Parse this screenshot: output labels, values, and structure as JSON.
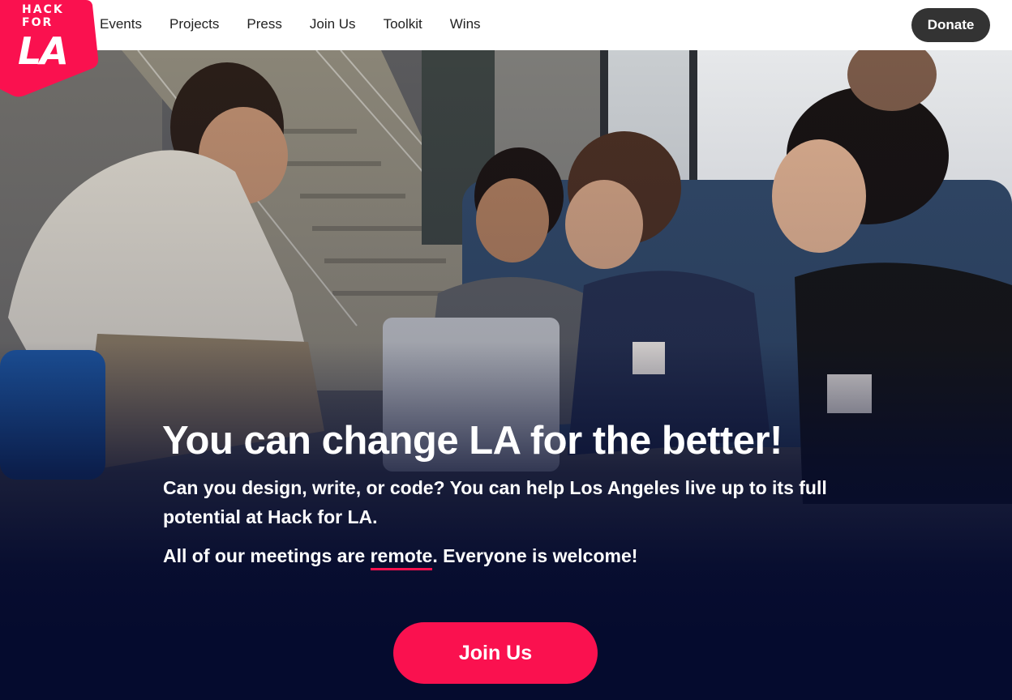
{
  "brand": {
    "logo_line1": "HACK",
    "logo_line2": "FOR",
    "logo_line3": "LA",
    "color": "#fa114f"
  },
  "nav": {
    "items": [
      {
        "label": "Events"
      },
      {
        "label": "Projects"
      },
      {
        "label": "Press"
      },
      {
        "label": "Join Us"
      },
      {
        "label": "Toolkit"
      },
      {
        "label": "Wins"
      }
    ],
    "donate_label": "Donate"
  },
  "hero": {
    "headline": "You can change LA for the better!",
    "description": "Can you design, write, or code? You can help Los Angeles live up to its full potential at Hack for LA.",
    "meetings_prefix": "All of our meetings are ",
    "meetings_highlight": "remote",
    "meetings_suffix": ". Everyone is welcome!",
    "cta_label": "Join Us",
    "cta_color": "#fa114f",
    "background_color": "#050b2e"
  }
}
